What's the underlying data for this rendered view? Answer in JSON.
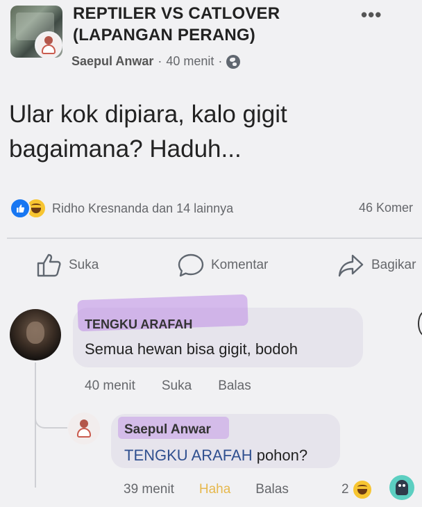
{
  "post": {
    "group_name_line1": "REPTILER VS CATLOVER",
    "group_name_line2": "(LAPANGAN PERANG)",
    "author": "Saepul Anwar",
    "time": "40 menit",
    "separator": "·",
    "privacy_icon": "globe-icon",
    "more_icon": "•••",
    "text": "Ular kok dipiara, kalo gigit bagaimana? Haduh..."
  },
  "reactions": {
    "icons": [
      "like-icon",
      "haha-icon"
    ],
    "summary": "Ridho Kresnanda dan 14 lainnya",
    "comment_count": "46 Komer"
  },
  "actions": {
    "like": "Suka",
    "comment": "Komentar",
    "share": "Bagikar"
  },
  "comments": [
    {
      "name": "TENGKU ARAFAH",
      "text": "Semua hewan bisa gigit, bodoh",
      "time": "40 menit",
      "like": "Suka",
      "reply": "Balas"
    }
  ],
  "reply": {
    "name": "Saepul Anwar",
    "mention": "TENGKU ARAFAH",
    "text": " pohon?",
    "time": "39 menit",
    "reaction_label": "Haha",
    "reply_label": "Balas",
    "reaction_count": "2"
  },
  "colors": {
    "background": "#f1f1f3",
    "bubble": "#e6e4ec",
    "like_blue": "#1877f2",
    "haha_yellow": "#f7c531",
    "highlight": "#be8ce6",
    "mention": "#2f4f8f"
  }
}
